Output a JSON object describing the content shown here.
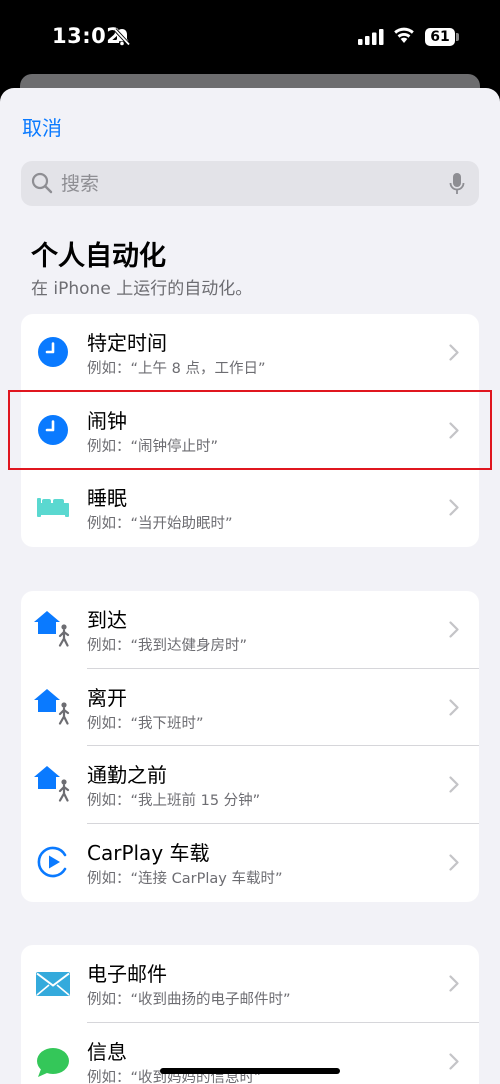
{
  "status": {
    "time": "13:02",
    "battery": "61"
  },
  "header": {
    "cancel_label": "取消"
  },
  "search": {
    "placeholder": "搜索"
  },
  "page": {
    "title": "个人自动化",
    "subtitle": "在 iPhone 上运行的自动化。"
  },
  "groups": [
    {
      "items": [
        {
          "title": "特定时间",
          "subtitle": "例如：“上午 8 点，工作日”",
          "icon": "clock-icon"
        },
        {
          "title": "闹钟",
          "subtitle": "例如：“闹钟停止时”",
          "icon": "clock-icon"
        },
        {
          "title": "睡眠",
          "subtitle": "例如：“当开始助眠时”",
          "icon": "bed-icon"
        }
      ]
    },
    {
      "items": [
        {
          "title": "到达",
          "subtitle": "例如：“我到达健身房时”",
          "icon": "home-walk-icon"
        },
        {
          "title": "离开",
          "subtitle": "例如：“我下班时”",
          "icon": "home-walk-icon"
        },
        {
          "title": "通勤之前",
          "subtitle": "例如：“我上班前 15 分钟”",
          "icon": "home-walk-icon"
        },
        {
          "title": "CarPlay 车载",
          "subtitle": "例如：“连接 CarPlay 车载时”",
          "icon": "carplay-icon"
        }
      ]
    },
    {
      "items": [
        {
          "title": "电子邮件",
          "subtitle": "例如：“收到曲扬的电子邮件时”",
          "icon": "mail-icon"
        },
        {
          "title": "信息",
          "subtitle": "例如：“收到妈妈的信息时”",
          "icon": "message-icon"
        }
      ]
    }
  ],
  "colors": {
    "accent": "#0a7aff",
    "highlight": "#e0161f",
    "bed": "#5ad8d0",
    "mail": "#34aadc",
    "message": "#34c759"
  }
}
